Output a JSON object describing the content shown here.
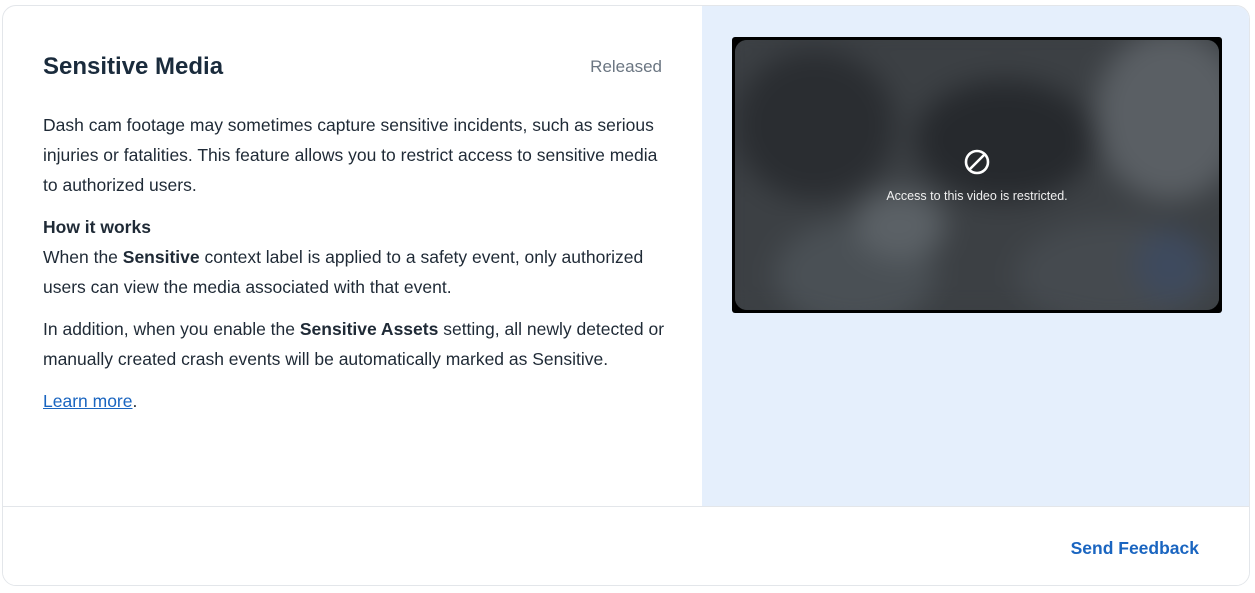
{
  "feature": {
    "title": "Sensitive Media",
    "status": "Released",
    "intro": "Dash cam footage may sometimes capture sensitive incidents, such as serious injuries or fatalities. This feature allows you to restrict access to sensitive media to authorized users.",
    "how_title": "How it works",
    "how_prefix": "When the ",
    "how_bold": "Sensitive",
    "how_suffix": " context label is applied to a safety event, only authorized users can view the media associated with that event.",
    "addition_prefix": "In addition, when you enable the ",
    "addition_bold": "Sensitive Assets",
    "addition_suffix": " setting, all newly detected or manually created crash events will be automatically marked as Sensitive.",
    "learn_more": "Learn more",
    "learn_more_suffix": "."
  },
  "video": {
    "restricted_text": "Access to this video is restricted.",
    "icon": "restricted-icon"
  },
  "footer": {
    "feedback_label": "Send Feedback"
  },
  "colors": {
    "accent": "#1a65c0",
    "panel_bg": "#e5effc",
    "title": "#1a2b3c",
    "status": "#6b7682"
  }
}
